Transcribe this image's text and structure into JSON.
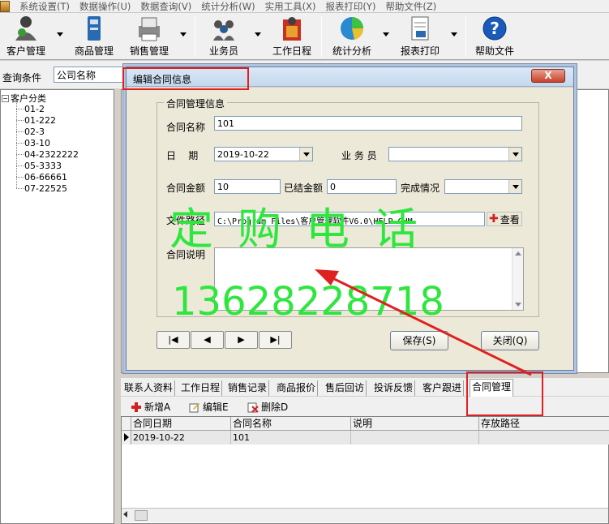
{
  "menu": [
    "系统设置(T)",
    "数据操作(U)",
    "数据查询(V)",
    "统计分析(W)",
    "实用工具(X)",
    "报表打印(Y)",
    "帮助文件(Z)"
  ],
  "toolbar": {
    "customer": "客户管理",
    "product": "商品管理",
    "sales": "销售管理",
    "staff": "业务员",
    "schedule": "工作日程",
    "stats": "统计分析",
    "report": "报表打印",
    "help": "帮助文件"
  },
  "query": {
    "label": "查询条件",
    "field": "公司名称"
  },
  "tree": {
    "root": "客户分类",
    "items": [
      "01-2",
      "01-222",
      "02-3",
      "03-10",
      "04-2322222",
      "05-3333",
      "06-66661",
      "07-22525"
    ]
  },
  "dialog": {
    "title": "编辑合同信息",
    "close": "X",
    "group_title": "合同管理信息",
    "name_label": "合同名称",
    "name_value": "101",
    "date_label": "日    期",
    "date_value": "2019-10-22",
    "staff_label": "业 务 员",
    "staff_value": "",
    "amount_label": "合同金额",
    "amount_value": "10",
    "settled_label": "已结金额",
    "settled_value": "0",
    "status_label": "完成情况",
    "status_value": "",
    "path_label": "文件路径",
    "path_value": "C:\\Program Files\\客户管理软件V6.0\\HELP.CHM",
    "view_label": "查看",
    "desc_label": "合同说明",
    "desc_value": "",
    "nav": [
      "|◀",
      "◀",
      "▶",
      "▶|"
    ],
    "save": "保存(S)",
    "close_btn": "关闭(Q)"
  },
  "ad": {
    "line1": "定购电话",
    "line2": "13628228718"
  },
  "tabs": [
    "联系人资料",
    "工作日程",
    "销售记录",
    "商品报价",
    "售后回访",
    "投诉反馈",
    "客户跟进",
    "合同管理"
  ],
  "actions": {
    "add": "新增A",
    "edit": "编辑E",
    "delete": "删除D"
  },
  "grid": {
    "headers": [
      "合同日期",
      "合同名称",
      "说明",
      "存放路径"
    ],
    "rows": [
      [
        "2019-10-22",
        "101",
        "",
        ""
      ]
    ]
  },
  "colors": {
    "ad_green": "#2ee63e",
    "annotation_red": "#e02020"
  }
}
